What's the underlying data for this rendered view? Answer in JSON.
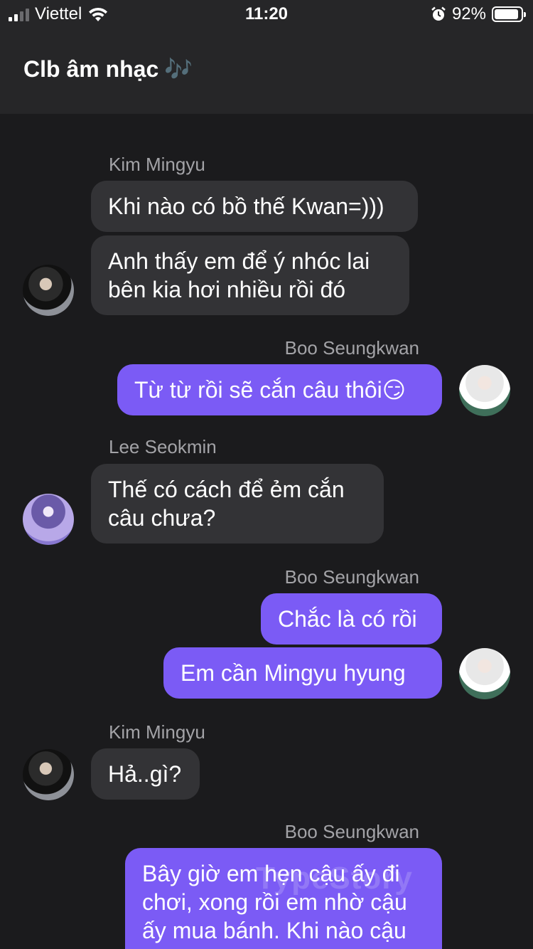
{
  "status_bar": {
    "carrier": "Viettel",
    "time": "11:20",
    "battery_percent": "92%",
    "battery_level": 0.92,
    "signal_icon": "cellular-signal-icon",
    "wifi_icon": "wifi-icon",
    "alarm_icon": "alarm-clock-icon",
    "battery_icon": "battery-icon"
  },
  "header": {
    "title": "Clb âm nhạc",
    "title_emoji": "🎶"
  },
  "messages": [
    {
      "sender": "Kim Mingyu",
      "direction": "incoming",
      "text": "Khi nào có bồ thế Kwan=)))"
    },
    {
      "direction": "incoming",
      "text": "Anh thấy em để ý nhóc lai bên kia hơi nhiều rồi đó"
    },
    {
      "sender": "Boo Seungkwan",
      "direction": "outgoing",
      "text": "Từ từ rồi sẽ cắn câu thôi😏"
    },
    {
      "sender": "Lee Seokmin",
      "direction": "incoming",
      "text": "Thế có cách để ẻm cắn câu chưa?"
    },
    {
      "sender": "Boo Seungkwan",
      "direction": "outgoing",
      "text": "Chắc là có rồi"
    },
    {
      "direction": "outgoing",
      "text": "Em cần Mingyu hyung"
    },
    {
      "sender": "Kim Mingyu",
      "direction": "incoming",
      "text": "Hả..gì?"
    },
    {
      "sender": "Boo Seungkwan",
      "direction": "outgoing",
      "text": "Bây giờ em hẹn cậu ấy đi chơi, xong rồi em nhờ cậu ấy mua bánh. Khi nào cậu"
    }
  ],
  "watermark": "TypeStory",
  "colors": {
    "background": "#1b1b1d",
    "header": "#262628",
    "incoming_bubble": "#333336",
    "outgoing_bubble": "#7b5bf5",
    "sender_name": "#a3a3a7"
  }
}
